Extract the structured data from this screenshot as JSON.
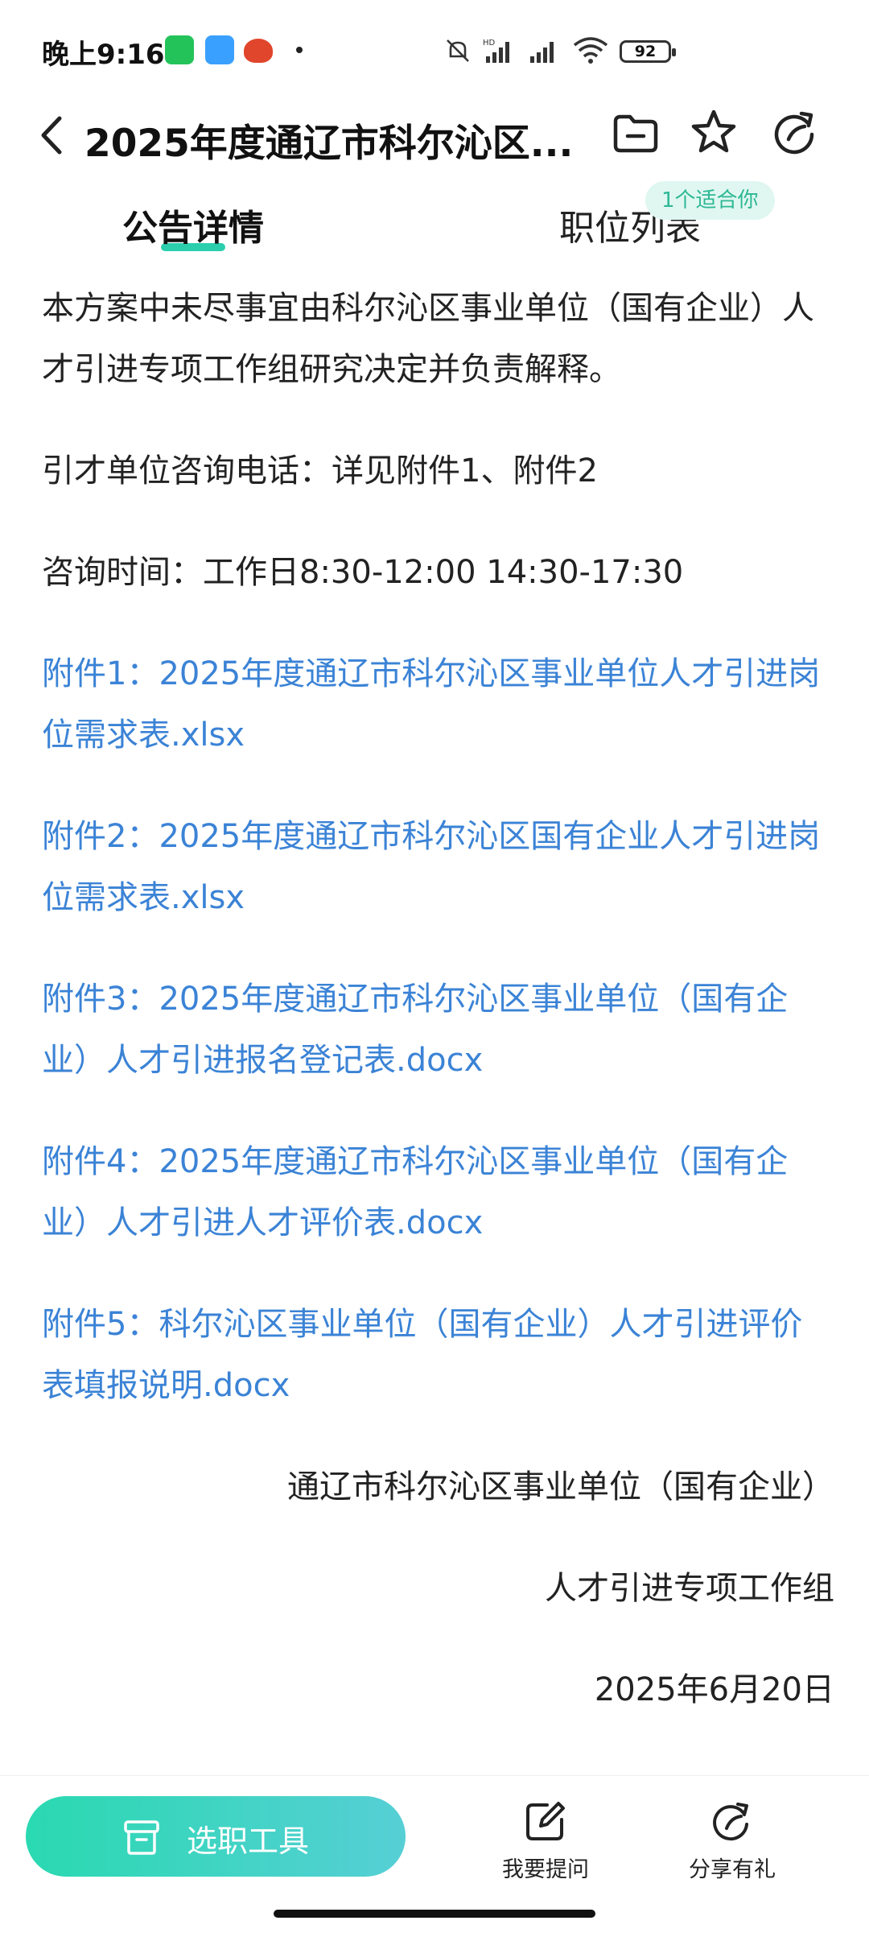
{
  "status_bar": {
    "time": "晚上9:16",
    "battery": "92",
    "icons": [
      "wechat-icon",
      "cloud-icon",
      "bot-icon",
      "mute-icon",
      "signal-hd-icon",
      "signal-icon",
      "wifi-icon",
      "battery-icon"
    ]
  },
  "header": {
    "title": "2025年度通辽市科尔沁区...",
    "icons": [
      "back-icon",
      "folder-icon",
      "star-icon",
      "share-icon"
    ]
  },
  "tabs": [
    {
      "label": "公告详情",
      "active": true
    },
    {
      "label": "职位列表",
      "active": false
    }
  ],
  "badge": "1个适合你",
  "content": {
    "paragraphs": [
      "本方案中未尽事宜由科尔沁区事业单位（国有企业）人才引进专项工作组研究决定并负责解释。",
      "引才单位咨询电话：详见附件1、附件2",
      "咨询时间：工作日8:30-12:00  14:30-17:30"
    ],
    "attachments": [
      "附件1：2025年度通辽市科尔沁区事业单位人才引进岗位需求表.xlsx",
      "附件2：2025年度通辽市科尔沁区国有企业人才引进岗位需求表.xlsx",
      "附件3：2025年度通辽市科尔沁区事业单位（国有企业）人才引进报名登记表.docx",
      "附件4：2025年度通辽市科尔沁区事业单位（国有企业）人才引进人才评价表.docx",
      "附件5：科尔沁区事业单位（国有企业）人才引进评价表填报说明.docx"
    ],
    "signature": {
      "org_line1": "通辽市科尔沁区事业单位（国有企业）",
      "org_line2": "人才引进专项工作组",
      "date": "2025年6月20日"
    }
  },
  "bottom_bar": {
    "tool_button": "选职工具",
    "ask": "我要提问",
    "share": "分享有礼"
  },
  "colors": {
    "accent": "#2bcfae",
    "link": "#3b83d6",
    "badge_bg": "#e0f7f1",
    "badge_text": "#2db894"
  }
}
